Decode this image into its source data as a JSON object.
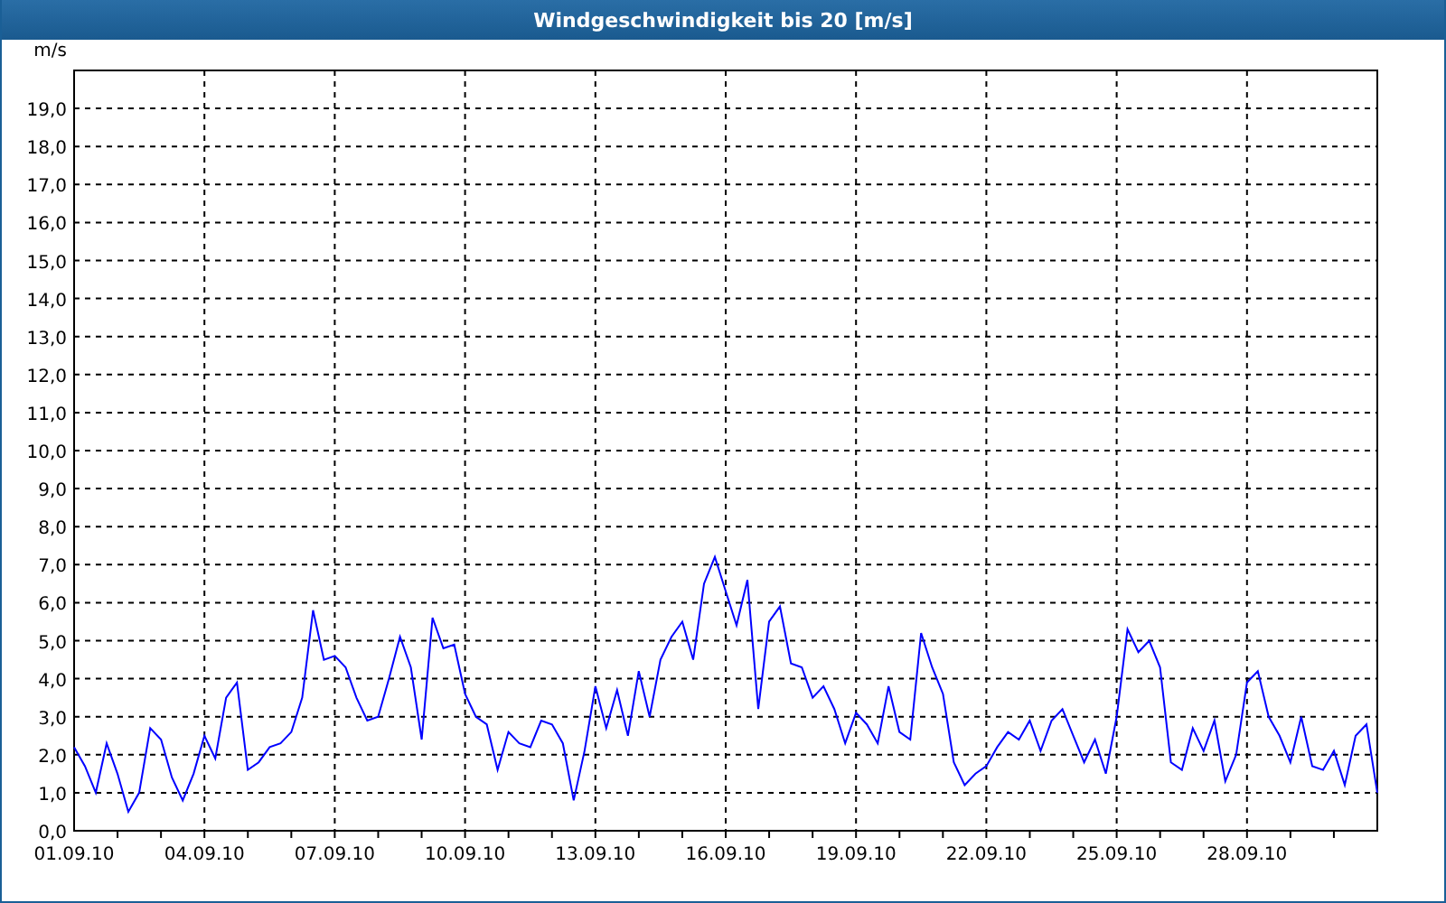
{
  "window": {
    "title": "Windgeschwindigkeit bis 20 [m/s]"
  },
  "chart": {
    "chart_data": {
      "type": "line",
      "ylabel": "m/s",
      "ylim": [
        0,
        20
      ],
      "grid": true,
      "yticks": [
        {
          "value": 0,
          "label": "0,0"
        },
        {
          "value": 1,
          "label": "1,0"
        },
        {
          "value": 2,
          "label": "2,0"
        },
        {
          "value": 3,
          "label": "3,0"
        },
        {
          "value": 4,
          "label": "4,0"
        },
        {
          "value": 5,
          "label": "5,0"
        },
        {
          "value": 6,
          "label": "6,0"
        },
        {
          "value": 7,
          "label": "7,0"
        },
        {
          "value": 8,
          "label": "8,0"
        },
        {
          "value": 9,
          "label": "9,0"
        },
        {
          "value": 10,
          "label": "10,0"
        },
        {
          "value": 11,
          "label": "11,0"
        },
        {
          "value": 12,
          "label": "12,0"
        },
        {
          "value": 13,
          "label": "13,0"
        },
        {
          "value": 14,
          "label": "14,0"
        },
        {
          "value": 15,
          "label": "15,0"
        },
        {
          "value": 16,
          "label": "16,0"
        },
        {
          "value": 17,
          "label": "17,0"
        },
        {
          "value": 18,
          "label": "18,0"
        },
        {
          "value": 19,
          "label": "19,0"
        }
      ],
      "categories": [
        "01.09.10",
        null,
        null,
        null,
        null,
        null,
        null,
        null,
        null,
        null,
        null,
        null,
        "04.09.10",
        null,
        null,
        null,
        null,
        null,
        null,
        null,
        null,
        null,
        null,
        null,
        "07.09.10",
        null,
        null,
        null,
        null,
        null,
        null,
        null,
        null,
        null,
        null,
        null,
        "10.09.10",
        null,
        null,
        null,
        null,
        null,
        null,
        null,
        null,
        null,
        null,
        null,
        "13.09.10",
        null,
        null,
        null,
        null,
        null,
        null,
        null,
        null,
        null,
        null,
        null,
        "16.09.10",
        null,
        null,
        null,
        null,
        null,
        null,
        null,
        null,
        null,
        null,
        null,
        "19.09.10",
        null,
        null,
        null,
        null,
        null,
        null,
        null,
        null,
        null,
        null,
        null,
        "22.09.10",
        null,
        null,
        null,
        null,
        null,
        null,
        null,
        null,
        null,
        null,
        null,
        "25.09.10",
        null,
        null,
        null,
        null,
        null,
        null,
        null,
        null,
        null,
        null,
        null,
        "28.09.10",
        null,
        null,
        null,
        null,
        null,
        null,
        null,
        null,
        null,
        null,
        null,
        null
      ],
      "values": [
        2.2,
        1.7,
        1.0,
        2.3,
        1.5,
        0.5,
        1.0,
        2.7,
        2.4,
        1.4,
        0.8,
        1.5,
        2.5,
        1.9,
        3.5,
        3.9,
        1.6,
        1.8,
        2.2,
        2.3,
        2.6,
        3.5,
        5.8,
        4.5,
        4.6,
        4.3,
        3.5,
        2.9,
        3.0,
        4.0,
        5.1,
        4.3,
        2.4,
        5.6,
        4.8,
        4.9,
        3.6,
        3.0,
        2.8,
        1.6,
        2.6,
        2.3,
        2.2,
        2.9,
        2.8,
        2.3,
        0.8,
        2.1,
        3.8,
        2.7,
        3.7,
        2.5,
        4.2,
        3.0,
        4.5,
        5.1,
        5.5,
        4.5,
        6.5,
        7.2,
        6.3,
        5.4,
        6.6,
        3.2,
        5.5,
        5.9,
        4.4,
        4.3,
        3.5,
        3.8,
        3.2,
        2.3,
        3.1,
        2.8,
        2.3,
        3.8,
        2.6,
        2.4,
        5.2,
        4.3,
        3.6,
        1.8,
        1.2,
        1.5,
        1.7,
        2.2,
        2.6,
        2.4,
        2.9,
        2.1,
        2.9,
        3.2,
        2.5,
        1.8,
        2.4,
        1.5,
        3.0,
        5.3,
        4.7,
        5.0,
        4.3,
        1.8,
        1.6,
        2.7,
        2.1,
        2.9,
        1.3,
        2.0,
        3.9,
        4.2,
        3.0,
        2.5,
        1.8,
        3.0,
        1.7,
        1.6,
        2.1,
        1.2,
        2.5,
        2.8,
        1.0
      ]
    }
  }
}
